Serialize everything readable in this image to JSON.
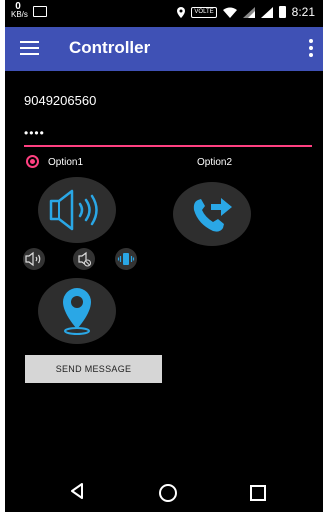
{
  "status_bar": {
    "speed_value": "0",
    "speed_unit": "KB/s",
    "volte_label": "VOLTE",
    "time": "8:21"
  },
  "app_bar": {
    "title": "Controller"
  },
  "form": {
    "phone_number": "9049206560",
    "password_mask": "••••"
  },
  "options": {
    "option1_label": "Option1",
    "option2_label": "Option2",
    "selected": "Option1"
  },
  "send_button_label": "SEND MESSAGE",
  "colors": {
    "app_bar": "#3f51b5",
    "accent": "#ff4081",
    "icon_blue": "#2aa7e6",
    "background": "#000000"
  },
  "icons": [
    "menu-icon",
    "overflow-menu-icon",
    "speaker-icon",
    "call-forward-icon",
    "volume-icon",
    "silent-icon",
    "vibrate-icon",
    "location-pin-icon"
  ]
}
